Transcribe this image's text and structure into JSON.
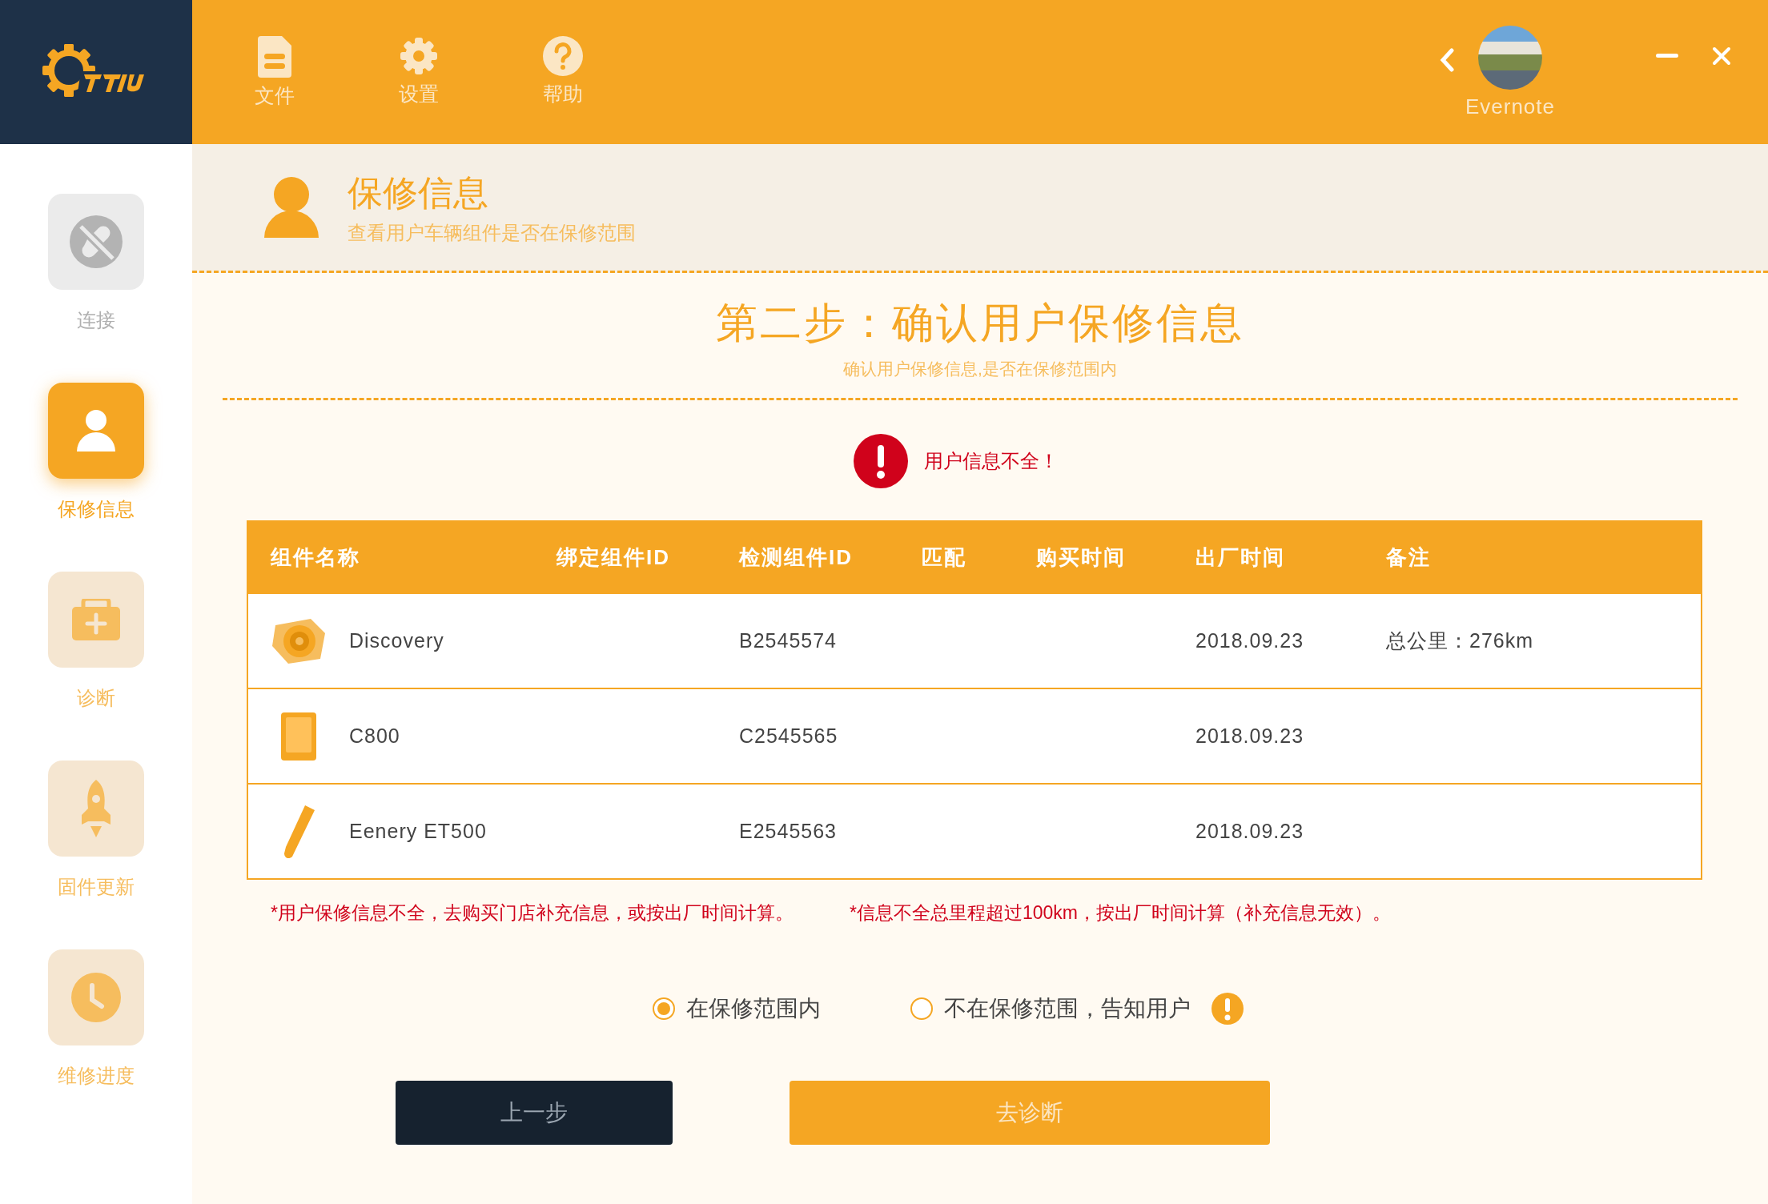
{
  "menu": [
    {
      "kind": "file",
      "label": "文件"
    },
    {
      "kind": "gear",
      "label": "设置"
    },
    {
      "kind": "help",
      "label": "帮助"
    }
  ],
  "account": {
    "name": "Evernote"
  },
  "sidebar": {
    "items": [
      {
        "kind": "plug",
        "label": "连接",
        "selected": false,
        "disabled": true
      },
      {
        "kind": "person",
        "label": "保修信息",
        "selected": true,
        "disabled": false
      },
      {
        "kind": "kit",
        "label": "诊断",
        "selected": false,
        "disabled": false
      },
      {
        "kind": "rocket",
        "label": "固件更新",
        "selected": false,
        "disabled": false
      },
      {
        "kind": "clock",
        "label": "维修进度",
        "selected": false,
        "disabled": false
      }
    ]
  },
  "header": {
    "title": "保修信息",
    "subtitle": "查看用户车辆组件是否在保修范围"
  },
  "step": {
    "title": "第二步：确认用户保修信息",
    "subtitle": "确认用户保修信息,是否在保修范围内"
  },
  "alert": {
    "text": "用户信息不全！"
  },
  "table": {
    "columns": [
      "组件名称",
      "绑定组件ID",
      "检测组件ID",
      "匹配",
      "购买时间",
      "出厂时间",
      "备注"
    ],
    "rows": [
      {
        "kind": "disc",
        "name": "Discovery",
        "detected_id": "B2545574",
        "factory_date": "2018.09.23",
        "note": "总公里：276km"
      },
      {
        "kind": "tablet",
        "name": "C800",
        "detected_id": "C2545565",
        "factory_date": "2018.09.23"
      },
      {
        "kind": "blade",
        "name": "Eenery ET500",
        "detected_id": "E2545563",
        "factory_date": "2018.09.23"
      }
    ]
  },
  "notes": [
    "*用户保修信息不全，去购买门店补充信息，或按出厂时间计算。",
    "*信息不全总里程超过100km，按出厂时间计算（补充信息无效）。"
  ],
  "options": [
    {
      "label": "在保修范围内",
      "selected": true,
      "warning": false
    },
    {
      "label": "不在保修范围，告知用户",
      "selected": false,
      "warning": true
    }
  ],
  "buttons": [
    {
      "kind": "secondary",
      "label": "上一步"
    },
    {
      "kind": "primary",
      "label": "去诊断"
    }
  ]
}
